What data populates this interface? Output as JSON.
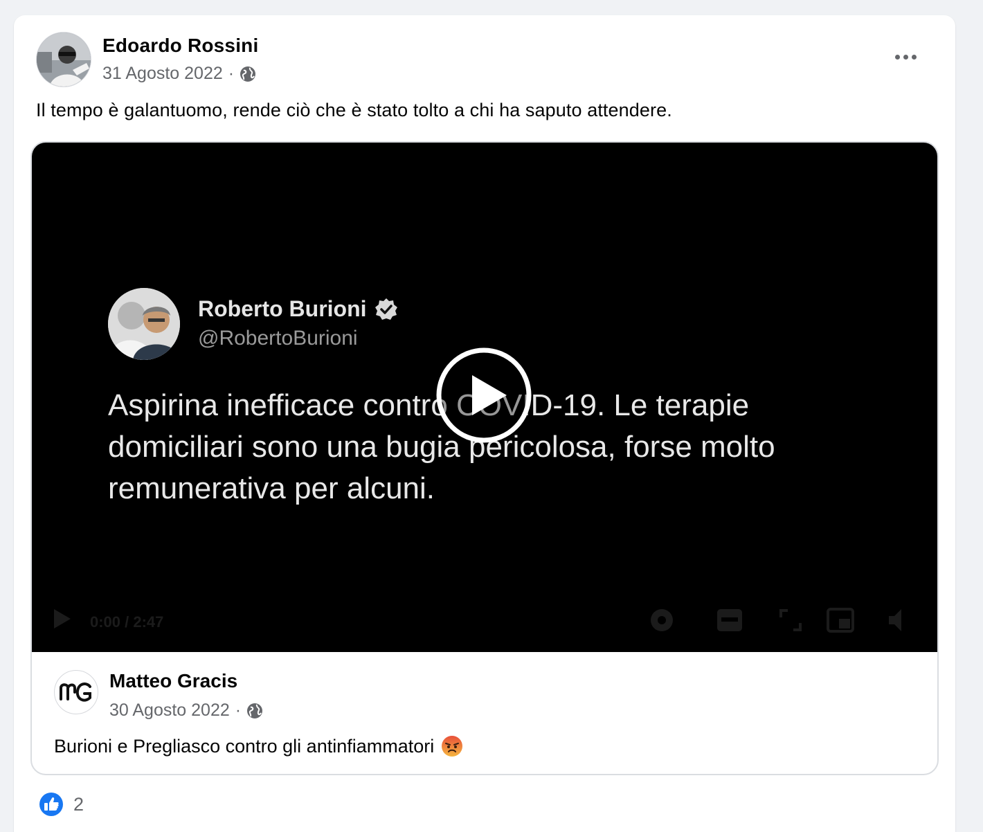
{
  "post": {
    "author": "Edoardo Rossini",
    "date": "31 Agosto 2022",
    "separator": "·",
    "privacy_icon": "globe-icon",
    "menu_icon": "more-options-icon",
    "text": "Il tempo è galantuomo, rende ciò che è stato tolto a chi ha saputo attendere."
  },
  "shared_video": {
    "tweet": {
      "name": "Roberto Burioni",
      "handle": "@RobertoBurioni",
      "verified_icon": "verified-badge-icon",
      "text": "Aspirina inefficace contro COVID-19. Le terapie domiciliari sono una bugia pericolosa, forse molto remunerativa per alcuni."
    },
    "play_icon": "play-icon",
    "time_readout": "0:00 / 2:47"
  },
  "shared_source": {
    "author": "Matteo Gracis",
    "date": "30 Agosto 2022",
    "separator": "·",
    "privacy_icon": "globe-icon",
    "text": "Burioni e Pregliasco contro gli antinfiammatori",
    "emoji_icon": "angry-face-icon"
  },
  "reactions": {
    "icon": "like-icon",
    "count": "2"
  },
  "colors": {
    "background": "#f0f2f5",
    "card": "#ffffff",
    "secondary_text": "#65676b",
    "like_blue": "#1877f2",
    "video_bg": "#000000"
  }
}
